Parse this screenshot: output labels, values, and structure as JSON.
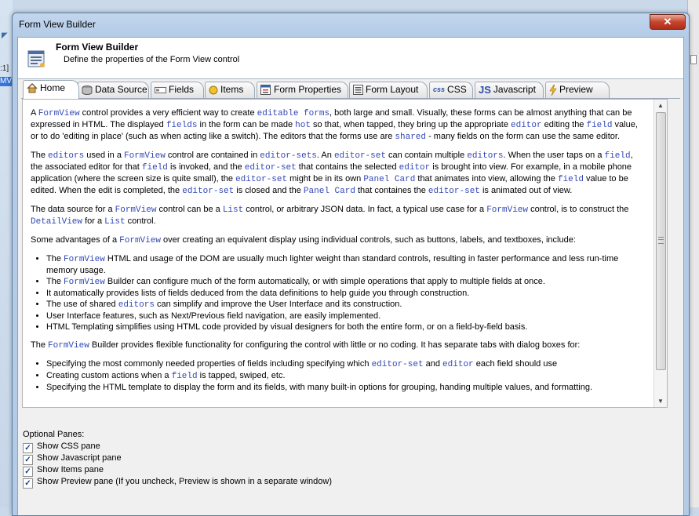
{
  "background": {
    "left_snippet_1": ":1]",
    "left_snippet_2": "MVI"
  },
  "window": {
    "title": "Form View Builder",
    "close_glyph": "✕"
  },
  "header": {
    "title": "Form View Builder",
    "subtitle": "Define the properties of the Form View control"
  },
  "tabs": [
    {
      "label": "Home",
      "icon": "home-icon",
      "active": true
    },
    {
      "label": "Data Source",
      "icon": "database-icon"
    },
    {
      "label": "Fields",
      "icon": "field-icon"
    },
    {
      "label": "Items",
      "icon": "items-icon"
    },
    {
      "label": "Form Properties",
      "icon": "form-properties-icon"
    },
    {
      "label": "Form Layout",
      "icon": "form-layout-icon"
    },
    {
      "label": "CSS",
      "icon": "css-icon",
      "icon_text": "css"
    },
    {
      "label": "Javascript",
      "icon": "javascript-icon",
      "icon_text": "JS"
    },
    {
      "label": "Preview",
      "icon": "lightning-icon"
    }
  ],
  "content": {
    "p1": [
      "A ",
      "FormView",
      " control provides a very efficient way to create ",
      "editable forms",
      ", both large and small. Visually, these forms can be almost anything that can be expressed in HTML. The displayed ",
      "fields",
      " in the form can be made ",
      "hot",
      " so that, when tapped, they bring up the appropriate ",
      "editor",
      " editing the ",
      "field",
      " value, or to do 'editing in place' (such as when acting like a switch). The editors that the forms use are ",
      "shared",
      " - many fields on the form can use the same editor."
    ],
    "p2": [
      "The ",
      "editors",
      " used in a ",
      "FormView",
      " control are contained in ",
      "editor-sets",
      ". An ",
      "editor-set",
      " can contain multiple ",
      "editors",
      ". When the user taps on a ",
      "field",
      ", the associated editor for that ",
      "field",
      " is invoked, and the ",
      "editor-set",
      " that contains the selected ",
      "editor",
      " is brought into view. For example, in a mobile phone application (where the screen size is quite small), the ",
      "editor-set",
      " might be in its own ",
      "Panel Card",
      " that animates into view, allowing the ",
      "field",
      " value to be edited. When the edit is completed, the ",
      "editor-set",
      " is closed and the ",
      "Panel Card",
      " that containes the ",
      "editor-set",
      " is animated out of view."
    ],
    "p3": [
      "The data source for a ",
      "FormView",
      " control can be a ",
      "List",
      " control, or arbitrary JSON data. In fact, a typical use case for a ",
      "FormView",
      " control, is to construct the ",
      "DetailView",
      " for a ",
      "List",
      " control."
    ],
    "p4": [
      "Some advantages of a ",
      "FormView",
      " over creating an equivalent display using individual controls, such as buttons, labels, and textboxes, include:"
    ],
    "list1": [
      [
        "The ",
        "FormView",
        " HTML and usage of the DOM are usually much lighter weight than standard controls, resulting in faster performance and less run-time memory usage."
      ],
      [
        "The ",
        "FormView",
        " Builder can configure much of the form automatically, or with simple operations that apply to multiple fields at once."
      ],
      [
        "It automatically provides lists of fields deduced from the data definitions to help guide you through construction."
      ],
      [
        "The use of shared ",
        "editors",
        " can simplify and improve the User Interface and its construction."
      ],
      [
        "User Interface features, such as Next/Previous field navigation, are easily implemented."
      ],
      [
        "HTML Templating simplifies using HTML code provided by visual designers for both the entire form, or on a field-by-field basis."
      ]
    ],
    "p5": [
      "The ",
      "FormView",
      " Builder provides flexible functionality for configuring the control with little or no coding. It has separate tabs with dialog boxes for:"
    ],
    "list2": [
      [
        "Specifying the most commonly needed properties of fields including specifying which ",
        "editor-set",
        " and ",
        "editor",
        " each field should use"
      ],
      [
        "Creating custom actions when a ",
        "field",
        " is tapped, swiped, etc."
      ],
      [
        "Specifying the HTML template to display the form and its fields, with many built-in options for grouping, handing multiple values, and formatting."
      ]
    ]
  },
  "optional_panes": {
    "label": "Optional Panes:",
    "options": [
      {
        "label": "Show CSS pane",
        "checked": true
      },
      {
        "label": "Show Javascript pane",
        "checked": true
      },
      {
        "label": "Show Items pane",
        "checked": true
      },
      {
        "label": "Show Preview pane (If you uncheck, Preview is shown in a separate window)",
        "checked": true
      }
    ]
  },
  "colors": {
    "code": "#3348b5",
    "close": "#c4452f",
    "frame": "#b4cbe6"
  }
}
